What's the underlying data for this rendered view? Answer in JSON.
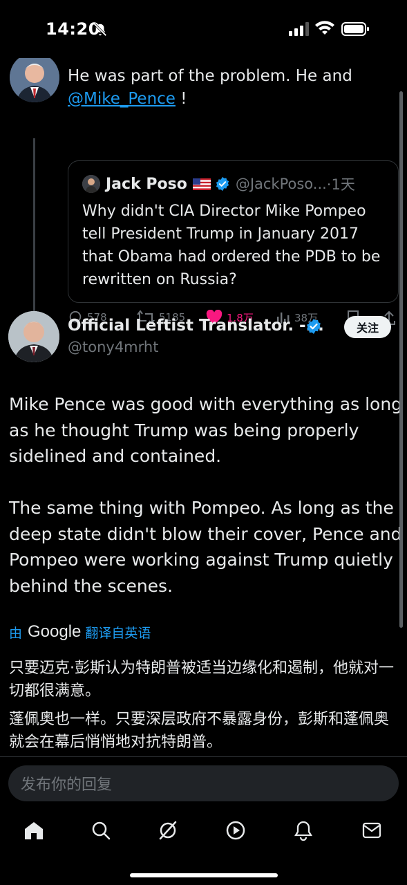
{
  "status_bar": {
    "time": "14:20"
  },
  "top_tweet": {
    "text_before": "He was part of the problem. He and",
    "mention": "@Mike_Pence",
    "text_after": " !",
    "quote": {
      "name": "Jack Poso",
      "flag": "🇺🇸",
      "handle": "@JackPoso...",
      "time": "·1天",
      "text": "Why didn't CIA Director Mike Pompeo tell President Trump in January 2017 that Obama had ordered the PDB to be rewritten on Russia?"
    },
    "actions": {
      "replies": "578",
      "reposts": "5185",
      "likes": "1.8万",
      "views": "38万"
    }
  },
  "main_tweet": {
    "name": "Official Leftist Translator. -...",
    "handle": "@tony4mrht",
    "follow_label": "关注",
    "paragraphs": [
      "Mike Pence was good with everything as long as he thought Trump was being properly sidelined and contained.",
      "The same thing with Pompeo. As long as the deep state didn't blow their cover, Pence and Pompeo were working against Trump quietly behind the scenes."
    ],
    "translation": {
      "prefix": "由",
      "provider": "Google",
      "suffix": "翻译自英语",
      "paragraphs": [
        "只要迈克·彭斯认为特朗普被适当边缘化和遏制，他就对一切都很满意。",
        "蓬佩奥也一样。只要深层政府不暴露身份，彭斯和蓬佩奥就会在幕后悄悄地对抗特朗普。"
      ]
    }
  },
  "reply": {
    "placeholder": "发布你的回复"
  },
  "colors": {
    "accent": "#1d9bf0",
    "like": "#f91880",
    "muted": "#71767b",
    "background": "#000000"
  },
  "icons": [
    "bell-off-icon",
    "signal-icon",
    "wifi-icon",
    "battery-icon",
    "verified-icon",
    "reply-icon",
    "repost-icon",
    "heart-icon",
    "views-icon",
    "bookmark-icon",
    "share-icon",
    "home-icon",
    "search-icon",
    "grok-icon",
    "video-icon",
    "notifications-icon",
    "messages-icon"
  ]
}
